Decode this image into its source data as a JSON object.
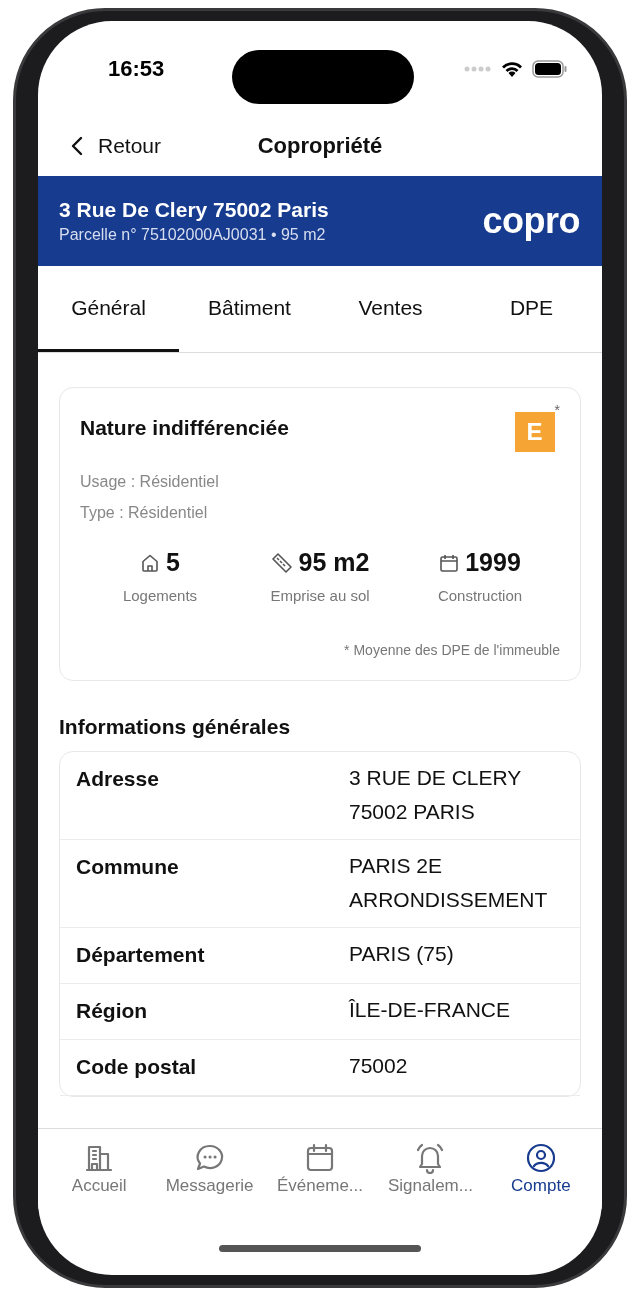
{
  "status_bar": {
    "time": "16:53"
  },
  "nav": {
    "back_label": "Retour",
    "title": "Copropriété"
  },
  "banner": {
    "title": "3 Rue De Clery 75002 Paris",
    "subtitle": "Parcelle n° 75102000AJ0031 • 95 m2",
    "logo": "copro"
  },
  "tabs": [
    {
      "label": "Général",
      "selected": true
    },
    {
      "label": "Bâtiment",
      "selected": false
    },
    {
      "label": "Ventes",
      "selected": false
    },
    {
      "label": "DPE",
      "selected": false
    }
  ],
  "summary_card": {
    "title": "Nature indifférenciée",
    "dpe": {
      "grade": "E",
      "color": "#f6a535",
      "mark": "*"
    },
    "lines": [
      "Usage : Résidentiel",
      "Type : Résidentiel"
    ],
    "stats": [
      {
        "kind": "home",
        "value": "5",
        "label": "Logements"
      },
      {
        "kind": "ruler",
        "value": "95 m2",
        "label": "Emprise au sol"
      },
      {
        "kind": "calendar",
        "value": "1999",
        "label": "Construction"
      }
    ],
    "footnote": "* Moyenne des DPE de l'immeuble"
  },
  "general_info": {
    "heading": "Informations générales",
    "rows": [
      {
        "label": "Adresse",
        "value": "3 RUE DE CLERY 75002 PARIS"
      },
      {
        "label": "Commune",
        "value": "PARIS 2E ARRONDISSEMENT"
      },
      {
        "label": "Département",
        "value": "PARIS (75)"
      },
      {
        "label": "Région",
        "value": "ÎLE-DE-FRANCE"
      },
      {
        "label": "Code postal",
        "value": "75002"
      }
    ]
  },
  "bottom_nav": [
    {
      "kind": "building",
      "label": "Accueil",
      "selected": false
    },
    {
      "kind": "chat",
      "label": "Messagerie",
      "selected": false
    },
    {
      "kind": "calendar",
      "label": "Événeme...",
      "selected": false
    },
    {
      "kind": "bell",
      "label": "Signalem...",
      "selected": false
    },
    {
      "kind": "account",
      "label": "Compte",
      "selected": true
    }
  ]
}
